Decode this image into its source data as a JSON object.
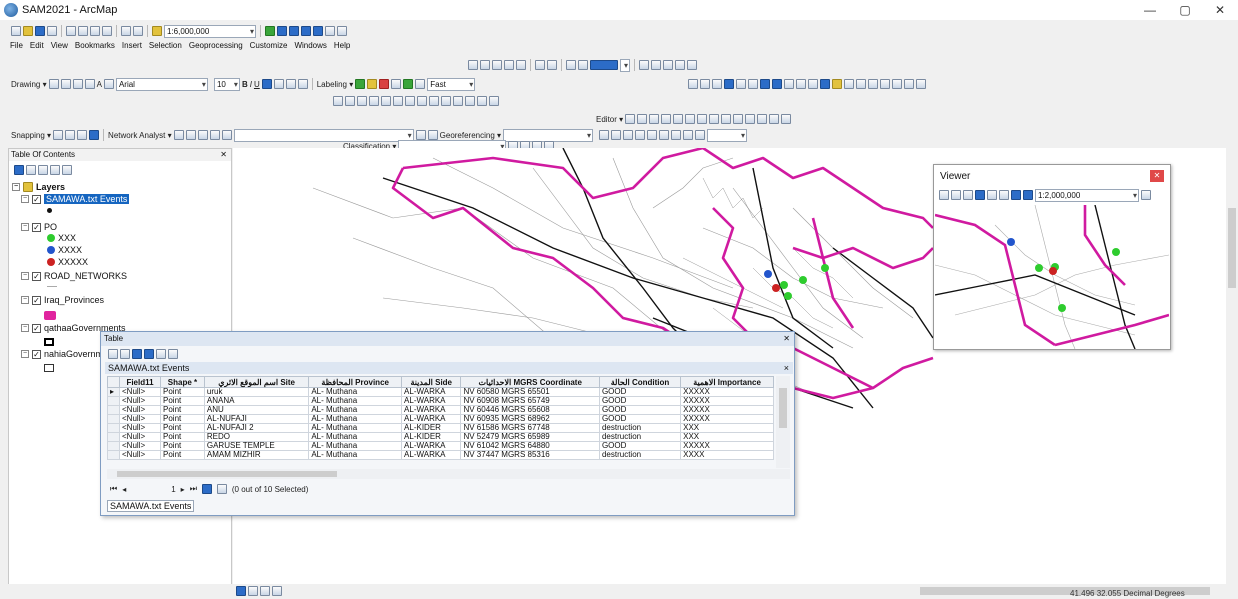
{
  "window": {
    "title": "SAM2021 - ArcMap",
    "minimize": "—",
    "maximize": "▢",
    "close": "✕"
  },
  "standard": {
    "scale": "1:6,000,000"
  },
  "menu": [
    "File",
    "Edit",
    "View",
    "Bookmarks",
    "Insert",
    "Selection",
    "Geoprocessing",
    "Customize",
    "Windows",
    "Help"
  ],
  "drawing": {
    "label": "Drawing ▾",
    "font": "Arial",
    "size": "10",
    "bold": "B",
    "italic": "I",
    "underline": "U",
    "text_a": "A"
  },
  "labeling": {
    "label": "Labeling ▾",
    "fast": "Fast"
  },
  "editor": {
    "label": "Editor ▾"
  },
  "snapping": {
    "label": "Snapping ▾",
    "network": "Network Analyst ▾",
    "georef": "Georeferencing ▾"
  },
  "classification": {
    "label": "Classification ▾"
  },
  "toc": {
    "title": "Table Of Contents",
    "close": "✕",
    "root": "Layers",
    "layers": [
      {
        "name": "SAMAWA.txt Events"
      },
      {
        "name": "PO",
        "classes": [
          {
            "label": "XXX",
            "color": "#2ecc2e"
          },
          {
            "label": "XXXX",
            "color": "#2255cc"
          },
          {
            "label": "XXXXX",
            "color": "#cc2222"
          }
        ]
      },
      {
        "name": "ROAD_NETWORKS"
      },
      {
        "name": "Iraq_Provinces",
        "color": "#e0249e"
      },
      {
        "name": "qathaaGovernments"
      },
      {
        "name": "nahiaGovernments"
      }
    ]
  },
  "viewer": {
    "title": "Viewer",
    "scale": "1:2,000,000",
    "close": "✕"
  },
  "table": {
    "window_title": "Table",
    "close": "✕",
    "layer_tab": "SAMAWA.txt Events",
    "layer_close": "×",
    "columns": [
      "Field11",
      "Shape *",
      "اسم الموقع الاثري Site",
      "المحافظة Province",
      "المدينة Side",
      "الاحداثيات MGRS Coordinate",
      "الحالة Condition",
      "الاهمية Importance"
    ],
    "rows": [
      [
        "<Null>",
        "Point",
        "uruk",
        "AL- Muthana",
        "AL-WARKA",
        "NV 60580 MGRS 65501",
        "GOOD",
        "XXXXX"
      ],
      [
        "<Null>",
        "Point",
        "ANANA",
        "AL- Muthana",
        "AL-WARKA",
        "NV 60908 MGRS 65749",
        "GOOD",
        "XXXXX"
      ],
      [
        "<Null>",
        "Point",
        "ANU",
        "AL- Muthana",
        "AL-WARKA",
        "NV 60446 MGRS 65608",
        "GOOD",
        "XXXXX"
      ],
      [
        "<Null>",
        "Point",
        "AL-NUFAJI",
        "AL- Muthana",
        "AL-WARKA",
        "NV 60935 MGRS 68962",
        "GOOD",
        "XXXXX"
      ],
      [
        "<Null>",
        "Point",
        "AL-NUFAJI 2",
        "AL- Muthana",
        "AL-KIDER",
        "NV 61586 MGRS 67748",
        "destruction",
        "XXX"
      ],
      [
        "<Null>",
        "Point",
        "REDO",
        "AL- Muthana",
        "AL-KIDER",
        "NV 52479 MGRS 65989",
        "destruction",
        "XXX"
      ],
      [
        "<Null>",
        "Point",
        "GARUSE TEMPLE",
        "AL- Muthana",
        "AL-WARKA",
        "NV 61042 MGRS 64880",
        "GOOD",
        "XXXXX"
      ],
      [
        "<Null>",
        "Point",
        "AMAM MIZHIR",
        "AL- Muthana",
        "AL-WARKA",
        "NV 37447 MGRS 85316",
        "destruction",
        "XXXX"
      ]
    ],
    "nav_current": "1",
    "selection": "(0 out of 10 Selected)",
    "bottom_tab": "SAMAWA.txt Events"
  },
  "status": {
    "coords": "41.496  32.055 Decimal Degrees"
  }
}
